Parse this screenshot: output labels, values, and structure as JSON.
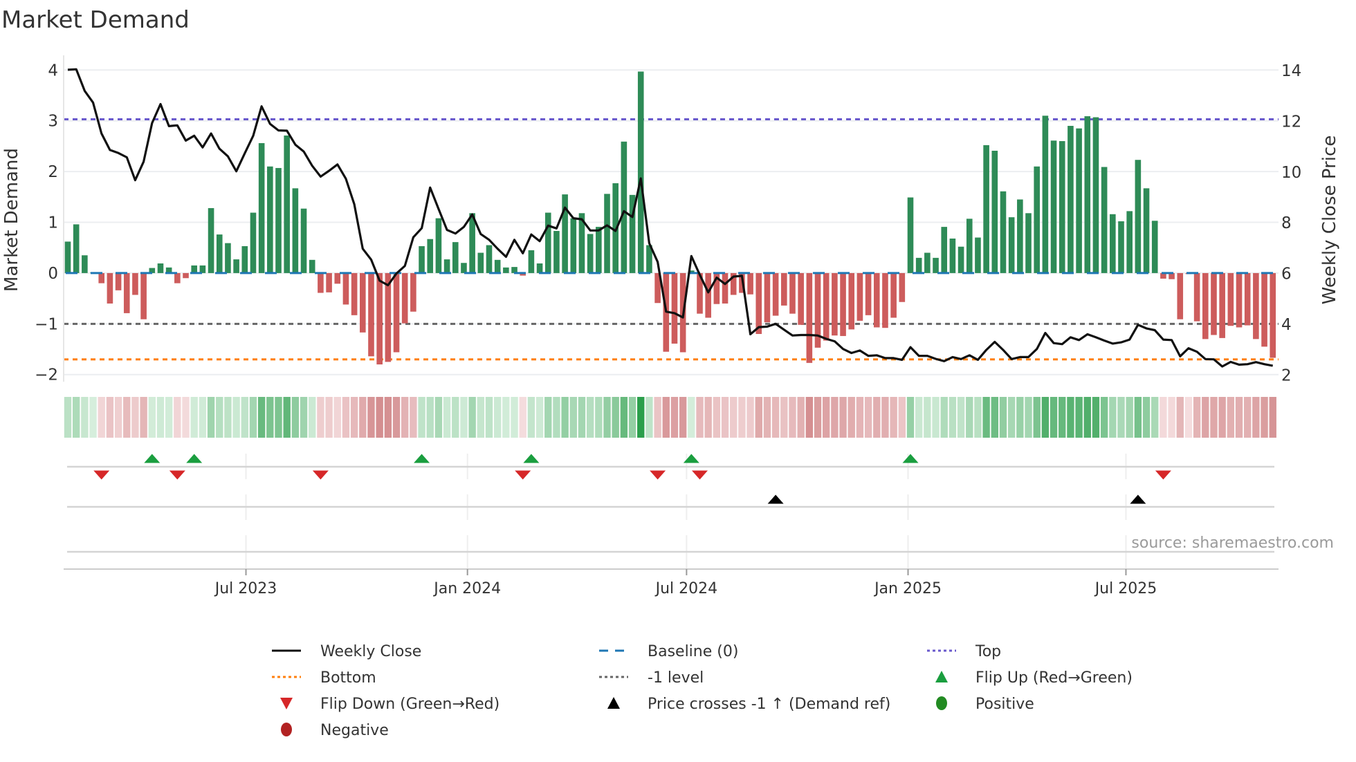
{
  "title": "Market Demand",
  "source": "source: sharemaestro.com",
  "colors": {
    "positive_bar": "#2e8b57",
    "negative_bar": "#cd5c5c",
    "price_line": "#111111",
    "baseline": "#1f77b4",
    "top": "#6a5acd",
    "bottom": "#ff7f0e",
    "minus_one": "#666666",
    "flip_up": "#1a9e3f",
    "flip_down": "#d62728",
    "price_cross": "#000000",
    "positive_dot": "#228b22",
    "negative_dot": "#b22222"
  },
  "legend": [
    {
      "label": "Weekly Close",
      "kind": "line-solid",
      "color": "#111111"
    },
    {
      "label": "Baseline (0)",
      "kind": "line-dashed",
      "color": "#1f77b4"
    },
    {
      "label": "Top",
      "kind": "line-dotted",
      "color": "#6a5acd"
    },
    {
      "label": "Bottom",
      "kind": "line-dotted",
      "color": "#ff7f0e"
    },
    {
      "label": "-1 level",
      "kind": "line-dotted",
      "color": "#666666"
    },
    {
      "label": "Flip Up (Red→Green)",
      "kind": "triangle-up",
      "color": "#1a9e3f"
    },
    {
      "label": "Flip Down (Green→Red)",
      "kind": "triangle-down",
      "color": "#d62728"
    },
    {
      "label": "Price crosses -1 ↑ (Demand ref)",
      "kind": "triangle-up",
      "color": "#000000"
    },
    {
      "label": "Positive",
      "kind": "dot",
      "color": "#228b22"
    },
    {
      "label": "Negative",
      "kind": "dot",
      "color": "#b22222"
    }
  ],
  "chart_data": {
    "type": "bar",
    "title": "Market Demand",
    "ylabel": "Market Demand",
    "ylabel_right": "Weekly Close Price",
    "ylim": [
      -2.14,
      4.29
    ],
    "ylim_right": [
      1.74,
      14.6
    ],
    "yticks": [
      {
        "v": -2,
        "label": "−2"
      },
      {
        "v": -1,
        "label": "−1"
      },
      {
        "v": 0,
        "label": "0"
      },
      {
        "v": 1,
        "label": "1"
      },
      {
        "v": 2,
        "label": "2"
      },
      {
        "v": 3,
        "label": "3"
      },
      {
        "v": 4,
        "label": "4"
      }
    ],
    "yticks_right": [
      {
        "v": 2,
        "label": "2"
      },
      {
        "v": 4,
        "label": "4"
      },
      {
        "v": 6,
        "label": "6"
      },
      {
        "v": 8,
        "label": "8"
      },
      {
        "v": 10,
        "label": "10"
      },
      {
        "v": 12,
        "label": "12"
      },
      {
        "v": 14,
        "label": "14"
      }
    ],
    "xticks": [
      {
        "date": "2023-07-01",
        "label": "Jul 2023"
      },
      {
        "date": "2024-01-01",
        "label": "Jan 2024"
      },
      {
        "date": "2024-07-01",
        "label": "Jul 2024"
      },
      {
        "date": "2025-01-01",
        "label": "Jan 2025"
      },
      {
        "date": "2025-07-01",
        "label": "Jul 2025"
      }
    ],
    "x_start": "2023-02-03",
    "x_step_days": 7,
    "levels": {
      "top": 3.03,
      "baseline": 0,
      "minus_one": -1,
      "bottom": -1.7
    },
    "series": [
      {
        "name": "Market Demand",
        "type": "bar",
        "values": [
          0.62,
          0.96,
          0.35,
          0.01,
          -0.2,
          -0.6,
          -0.34,
          -0.79,
          -0.43,
          -0.91,
          0.1,
          0.19,
          0.11,
          -0.2,
          -0.1,
          0.15,
          0.15,
          1.28,
          0.76,
          0.59,
          0.27,
          0.53,
          1.19,
          2.56,
          2.1,
          2.07,
          2.71,
          1.67,
          1.27,
          0.26,
          -0.39,
          -0.38,
          -0.21,
          -0.62,
          -0.83,
          -1.17,
          -1.64,
          -1.8,
          -1.75,
          -1.56,
          -0.99,
          -0.76,
          0.53,
          0.67,
          1.08,
          0.27,
          0.61,
          0.2,
          1.18,
          0.4,
          0.55,
          0.26,
          0.11,
          0.12,
          -0.05,
          0.45,
          0.19,
          1.19,
          0.83,
          1.55,
          1.08,
          1.18,
          0.77,
          0.91,
          1.56,
          1.77,
          2.59,
          1.54,
          3.97,
          0.55,
          -0.59,
          -1.55,
          -1.39,
          -1.56,
          0.05,
          -0.8,
          -0.88,
          -0.61,
          -0.6,
          -0.43,
          -0.39,
          -0.42,
          -1.2,
          -0.97,
          -0.84,
          -0.64,
          -0.8,
          -1.02,
          -1.77,
          -1.47,
          -1.33,
          -1.23,
          -1.24,
          -1.11,
          -0.94,
          -0.83,
          -1.07,
          -1.08,
          -0.88,
          -0.57,
          1.49,
          0.3,
          0.4,
          0.3,
          0.91,
          0.68,
          0.52,
          1.07,
          0.7,
          2.52,
          2.41,
          1.61,
          1.1,
          1.45,
          1.18,
          2.1,
          3.1,
          2.61,
          2.6,
          2.9,
          2.85,
          3.09,
          3.07,
          2.09,
          1.16,
          1.02,
          1.22,
          2.23,
          1.67,
          1.03,
          -0.11,
          -0.12,
          -0.91,
          -0.02,
          -0.95,
          -1.3,
          -1.22,
          -1.28,
          -1.04,
          -1.07,
          -1.03,
          -1.3,
          -1.45,
          -1.67
        ]
      },
      {
        "name": "Weekly Close",
        "type": "line",
        "axis": "right",
        "values": [
          14.03,
          14.05,
          13.2,
          12.74,
          11.52,
          10.87,
          10.75,
          10.58,
          9.68,
          10.41,
          11.93,
          12.68,
          11.81,
          11.84,
          11.24,
          11.43,
          10.97,
          11.52,
          10.92,
          10.62,
          10.03,
          10.74,
          11.43,
          12.59,
          11.9,
          11.64,
          11.63,
          11.08,
          10.81,
          10.25,
          9.82,
          10.05,
          10.3,
          9.74,
          8.73,
          6.98,
          6.55,
          5.72,
          5.54,
          6.0,
          6.3,
          7.43,
          7.79,
          9.39,
          8.55,
          7.72,
          7.58,
          7.84,
          8.33,
          7.56,
          7.33,
          6.98,
          6.66,
          7.33,
          6.8,
          7.54,
          7.28,
          7.89,
          7.78,
          8.6,
          8.18,
          8.14,
          7.7,
          7.7,
          7.9,
          7.68,
          8.46,
          8.23,
          9.75,
          7.2,
          6.46,
          4.5,
          4.44,
          4.27,
          6.69,
          5.95,
          5.26,
          5.84,
          5.59,
          5.88,
          5.91,
          3.61,
          3.89,
          3.91,
          4.02,
          3.79,
          3.56,
          3.58,
          3.58,
          3.56,
          3.43,
          3.33,
          3.03,
          2.87,
          2.97,
          2.76,
          2.78,
          2.67,
          2.67,
          2.6,
          3.1,
          2.76,
          2.76,
          2.64,
          2.55,
          2.71,
          2.63,
          2.78,
          2.6,
          2.99,
          3.31,
          2.99,
          2.63,
          2.71,
          2.71,
          3.03,
          3.66,
          3.26,
          3.22,
          3.49,
          3.38,
          3.61,
          3.49,
          3.36,
          3.24,
          3.29,
          3.4,
          3.98,
          3.84,
          3.77,
          3.4,
          3.38,
          2.74,
          3.06,
          2.92,
          2.63,
          2.62,
          2.34,
          2.52,
          2.41,
          2.43,
          2.51,
          2.43,
          2.37
        ]
      }
    ],
    "events": {
      "flip_up_index": [
        10,
        15,
        42,
        55,
        74,
        100
      ],
      "flip_down_index": [
        4,
        13,
        30,
        54,
        70,
        75,
        130
      ],
      "price_cross_up_index": [
        84,
        127
      ]
    },
    "grid": true,
    "legend_position": "bottom"
  }
}
